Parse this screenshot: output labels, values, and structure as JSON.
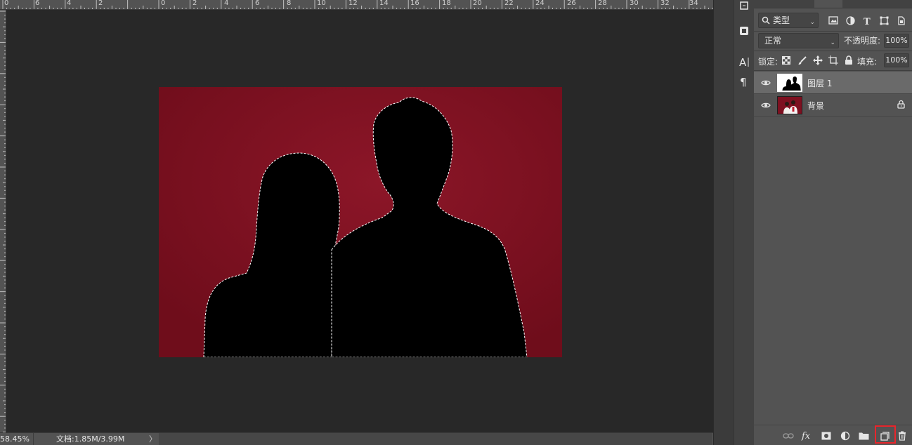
{
  "ruler": {
    "top_labels": [
      "0",
      "6",
      "4",
      "2",
      "0",
      "2",
      "4",
      "6",
      "8",
      "10",
      "12",
      "14",
      "16",
      "18",
      "20",
      "22",
      "24",
      "26",
      "28",
      "30",
      "32",
      "34"
    ]
  },
  "status_bar": {
    "zoom": "58.45%",
    "doc_info": "文档:1.85M/3.99M",
    "arrow": "〉"
  },
  "layers_panel": {
    "filter": {
      "label": "类型",
      "icons": [
        "image-filter-icon",
        "adjustment-filter-icon",
        "type-filter-icon",
        "shape-filter-icon",
        "smart-object-filter-icon"
      ]
    },
    "blend_mode": "正常",
    "opacity_label": "不透明度:",
    "opacity_value": "100%",
    "lock_label": "锁定:",
    "fill_label": "填充:",
    "fill_value": "100%",
    "layers": [
      {
        "name": "图层 1",
        "selected": true,
        "locked": false
      },
      {
        "name": "背景",
        "selected": false,
        "locked": true
      }
    ]
  },
  "colors": {
    "canvas_bg": "#282828",
    "document_bg": "#7e1020",
    "panel_bg": "#535353",
    "highlight": "#e8262c"
  }
}
